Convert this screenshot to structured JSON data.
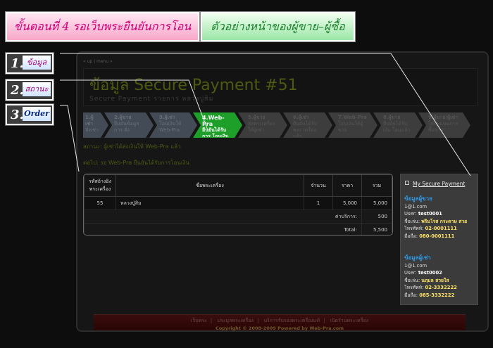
{
  "tutorial": {
    "step_button": "ขั้นตอนที่ 4  รอเว็บพระยืนยันการโอน",
    "example_button": "ตัวอย่างหน้าของผู้ขาย–ผู้ซื้อ"
  },
  "labels": [
    {
      "num": "1.",
      "text": "ข้อมูล"
    },
    {
      "num": "2.",
      "text": "สถานะ"
    },
    {
      "num": "3.",
      "text": "Order"
    }
  ],
  "breadcrumb": "« up | menu »",
  "page": {
    "title": "ข้อมูล Secure Payment #51",
    "subtitle": "Secure Payment รายการ หลวงปู่สิม"
  },
  "steps": [
    {
      "name": "1.ผู้เช่า",
      "desc": "สั่งเช่า",
      "state": "done"
    },
    {
      "name": "2.ผู้ขาย",
      "desc": "ยืนยันข้อมูลการ สั่ง",
      "state": "done"
    },
    {
      "name": "3.ผู้เช่า",
      "desc": "โอนเงินให้ Web-Pra",
      "state": "done"
    },
    {
      "name": "4.Web-Pra",
      "desc": "ยืนยันได้รับการ โอนเงินจากผู้เช่า",
      "state": "active"
    },
    {
      "name": "5.ผู้ขาย",
      "desc": "ส่งพระเครื่องให้ผู้เช่า",
      "state": "pending"
    },
    {
      "name": "6.ผู้เช่า",
      "desc": "ยืนยันได้รับพระ เครื่องแล้ว",
      "state": "pending"
    },
    {
      "name": "7.Web-Pra",
      "desc": "โอนเงินให้ผู้ขาย",
      "state": "pending"
    },
    {
      "name": "8.ผู้ขาย",
      "desc": "ยืนยันได้รับเงิน โอนแล้ว",
      "state": "pending"
    },
    {
      "name": "9.ผู้ขาย/ผู้เช่า",
      "desc": "ให้คะแนนการซื้อขาย",
      "state": "pending"
    }
  ],
  "status_line": "สถานะ: ผู้เช่าได้ส่งเงินให้ Web-Pra แล้ว",
  "next_line": "ต่อไป: รอ Web-Pra ยืนยันได้รับการโอนเงิน",
  "order": {
    "headers": [
      "รหัสอ้างอิง พระเครื่อง",
      "ชื่อพระเครื่อง",
      "จำนวน",
      "ราคา",
      "รวม"
    ],
    "items": [
      {
        "ref": "55",
        "name": "หลวงปู่สิม",
        "qty": "1",
        "price": "5,000",
        "total": "5,000"
      }
    ],
    "service_label": "ค่าบริการ:",
    "service_value": "500",
    "total_label": "Total:",
    "total_value": "5,500"
  },
  "sidebar": {
    "link": "My Secure Payment",
    "seller": {
      "heading": "ข้อมูลผู้ขาย",
      "email": "1@1.com",
      "user_label": "User:",
      "user": "test0001",
      "name_label": "ชื่อเล่น:",
      "name": "พริมโรส กระดาษ สวย",
      "phone_label": "โทรศัพท์:",
      "phone": "02-0001111",
      "mobile_label": "มือถือ:",
      "mobile": "080-0001111"
    },
    "buyer": {
      "heading": "ข้อมูลผู้เช่า",
      "email": "1@1.com",
      "user_label": "User:",
      "user": "test0002",
      "name_label": "ชื่อเล่น:",
      "name": "นฤมล สวยใส",
      "phone_label": "โทรศัพท์:",
      "phone": "02-3332222",
      "mobile_label": "มือถือ:",
      "mobile": "085-3332222"
    }
  },
  "footer": {
    "links": [
      "เว็บพระ",
      "ประมูลพระเครื่อง",
      "บริการรับรองพระเครื่องแท้",
      "เปิดร้านพระเครื่อง"
    ],
    "copyright": "Copyright © 2008-2009 Powered by Web-Pra.com"
  }
}
